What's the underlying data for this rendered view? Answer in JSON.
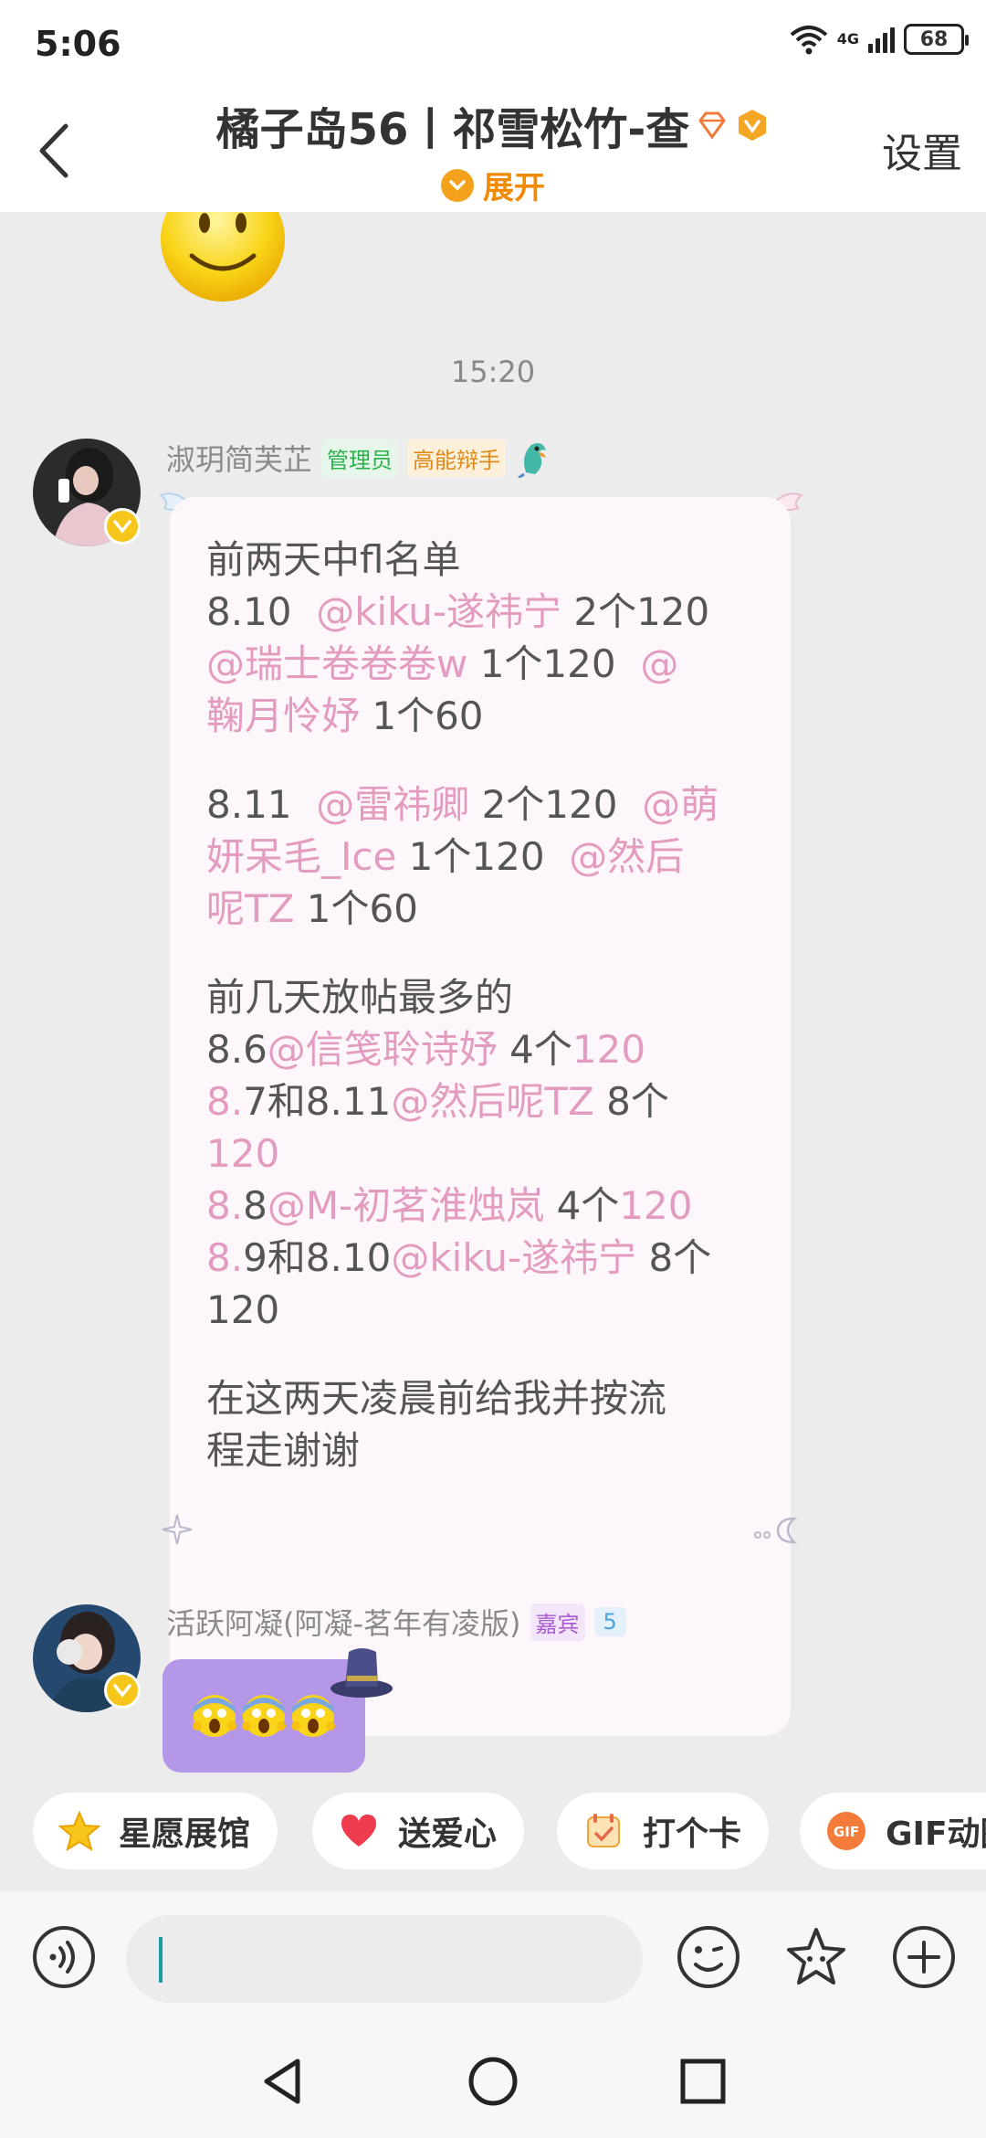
{
  "status_bar": {
    "time": "5:06",
    "network": "4G",
    "battery": "68"
  },
  "header": {
    "title": "橘子岛56丨祁雪松竹-查",
    "expand_label": "展开",
    "settings_label": "设置"
  },
  "chat": {
    "timestamp": "15:20",
    "message1": {
      "sender": "淑玥简芙芷",
      "tags": [
        "管理员",
        "高能辩手"
      ],
      "lines": [
        [
          {
            "t": "前两天中fl名单"
          }
        ],
        [
          {
            "t": "8.10  "
          },
          {
            "t": "@kiku-遂祎宁",
            "at": true
          },
          {
            "t": " 2个120"
          }
        ],
        [
          {
            "t": "@瑞士卷卷卷w",
            "at": true
          },
          {
            "t": " 1个120  "
          },
          {
            "t": "@",
            "at": true
          }
        ],
        [
          {
            "t": "鞠月怜妤",
            "at": true
          },
          {
            "t": " 1个60"
          }
        ],
        [],
        [
          {
            "t": "8.11  "
          },
          {
            "t": "@雷祎卿",
            "at": true
          },
          {
            "t": " 2个120  "
          },
          {
            "t": "@萌",
            "at": true
          }
        ],
        [
          {
            "t": "妍呆毛_Ice",
            "at": true
          },
          {
            "t": " 1个120  "
          },
          {
            "t": "@然后",
            "at": true
          }
        ],
        [
          {
            "t": "呢TZ",
            "at": true
          },
          {
            "t": " 1个60"
          }
        ],
        [],
        [
          {
            "t": "前几天放帖最多的"
          }
        ],
        [
          {
            "t": "8.6"
          },
          {
            "t": "@信笺聆诗妤",
            "at": true
          },
          {
            "t": " 4个"
          },
          {
            "t": "120",
            "at": true
          }
        ],
        [
          {
            "t": "8.",
            "at": true
          },
          {
            "t": "7和8.11"
          },
          {
            "t": "@然后呢TZ",
            "at": true
          },
          {
            "t": " 8个"
          }
        ],
        [
          {
            "t": "120",
            "at": true
          }
        ],
        [
          {
            "t": "8.",
            "at": true
          },
          {
            "t": "8"
          },
          {
            "t": "@M-初茗淮烛岚",
            "at": true
          },
          {
            "t": " 4个"
          },
          {
            "t": "120",
            "at": true
          }
        ],
        [
          {
            "t": "8.",
            "at": true
          },
          {
            "t": "9和8.10"
          },
          {
            "t": "@kiku-遂祎宁",
            "at": true
          },
          {
            "t": " 8个"
          }
        ],
        [
          {
            "t": "120"
          }
        ],
        [],
        [
          {
            "t": "在这两天凌晨前给我并按流"
          }
        ],
        [
          {
            "t": "程走谢谢"
          }
        ]
      ]
    },
    "message2": {
      "sender": "活跃阿凝(阿凝-茗年有凌版)",
      "tags": [
        "嘉宾",
        "5"
      ]
    }
  },
  "chips": [
    {
      "label": "星愿展馆",
      "icon": "star-icon"
    },
    {
      "label": "送爱心",
      "icon": "heart-icon"
    },
    {
      "label": "打个卡",
      "icon": "checkin-icon"
    },
    {
      "label": "GIF动图",
      "icon": "gif-icon"
    }
  ],
  "colors": {
    "accent": "#f4a21c",
    "mention": "#e39cbf",
    "bubble_self": "#fdf6fa",
    "bubble_emoji": "#b497e6"
  }
}
